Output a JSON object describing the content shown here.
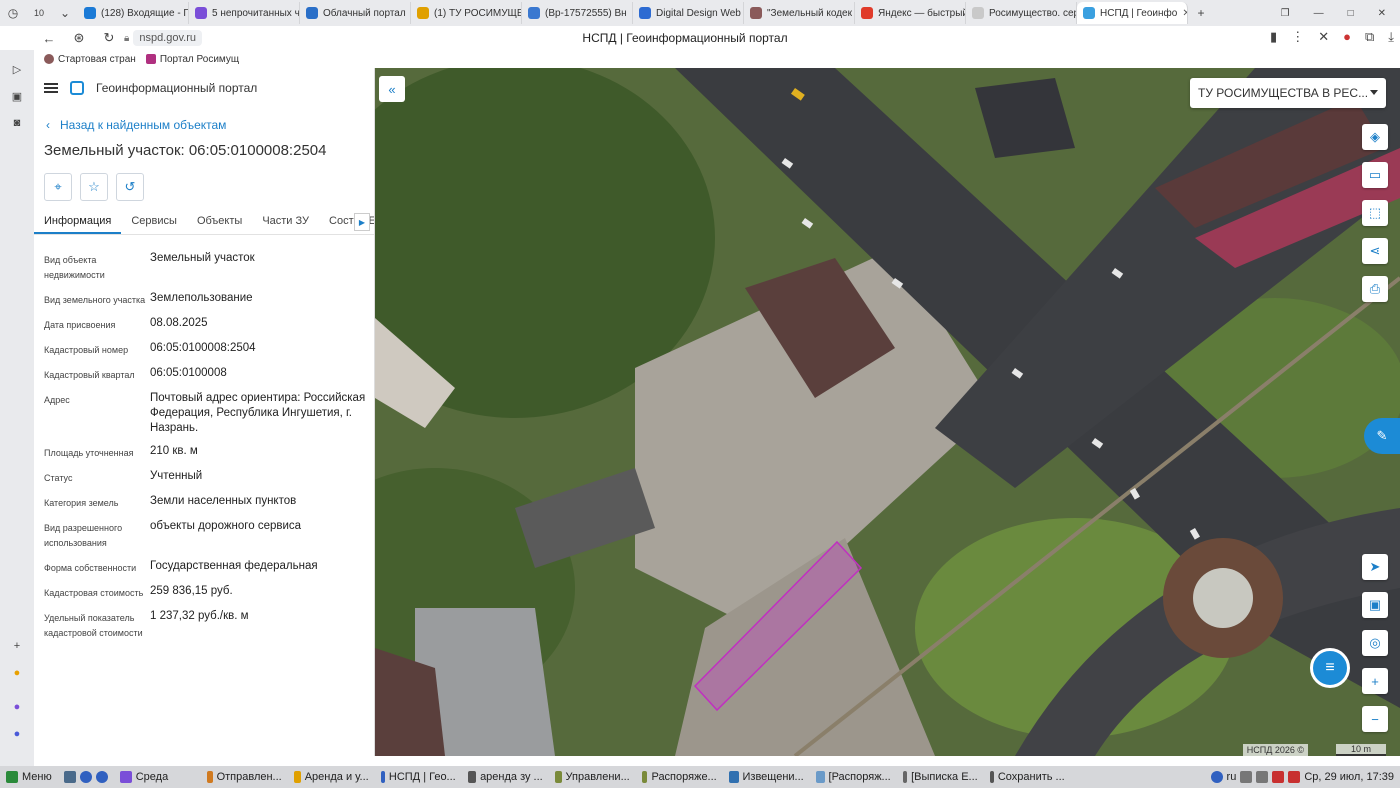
{
  "browser": {
    "tab_counter": "10",
    "tabs": [
      {
        "label": "(128) Входящие - П",
        "color": "#1b7ad6"
      },
      {
        "label": "5 непрочитанных ч",
        "color": "#7a4ed8"
      },
      {
        "label": "Облачный портал",
        "color": "#2a6fc8"
      },
      {
        "label": "(1) ТУ РОСИМУЩЕ",
        "color": "#e0a000"
      },
      {
        "label": "(Вр-17572555) Вн",
        "color": "#3a78d0"
      },
      {
        "label": "Digital Design Web",
        "color": "#2d6bd2"
      },
      {
        "label": "\"Земельный кодек",
        "color": "#8a5a5a"
      },
      {
        "label": "Яндекс — быстрый",
        "color": "#e03b2a"
      },
      {
        "label": "Росимущество. сер",
        "color": "#c9c9c9"
      },
      {
        "label": "НСПД | Геоинфо",
        "color": "#3aa0e0"
      }
    ],
    "url": "nspd.gov.ru",
    "page_title": "НСПД | Геоинформационный портал",
    "bookmarks": [
      "Стартовая стран",
      "Портал Росимущ"
    ]
  },
  "portal": {
    "name": "Геоинформационный портал",
    "back_link": "Назад к найденным объектам",
    "object_title": "Земельный участок: 06:05:0100008:2504",
    "tabs": [
      "Информация",
      "Сервисы",
      "Объекты",
      "Части ЗУ",
      "Состав Е"
    ],
    "properties": [
      {
        "key": "Вид объекта недвижимости",
        "value": "Земельный участок"
      },
      {
        "key": "Вид земельного участка",
        "value": "Землепользование"
      },
      {
        "key": "Дата присвоения",
        "value": "08.08.2025"
      },
      {
        "key": "Кадастровый номер",
        "value": "06:05:0100008:2504"
      },
      {
        "key": "Кадастровый квартал",
        "value": "06:05:0100008"
      },
      {
        "key": "Адрес",
        "value": "Почтовый адрес ориентира: Российская Федерация, Республика Ингушетия, г. Назрань."
      },
      {
        "key": "Площадь уточненная",
        "value": "210 кв. м"
      },
      {
        "key": "Статус",
        "value": "Учтенный"
      },
      {
        "key": "Категория земель",
        "value": "Земли населенных пунктов"
      },
      {
        "key": "Вид разрешенного использования",
        "value": "объекты дорожного сервиса"
      },
      {
        "key": "Форма собственности",
        "value": "Государственная федеральная"
      },
      {
        "key": "Кадастровая стоимость",
        "value": "259 836,15 руб."
      },
      {
        "key": "Удельный показатель кадастровой стоимости",
        "value": "1 237,32 руб./кв. м"
      }
    ]
  },
  "map": {
    "layer_select": "ТУ РОСИМУЩЕСТВА В РЕС...",
    "credit": "НСПД 2026 ©",
    "scale": "10 m"
  },
  "taskbar": {
    "menu": "Меню",
    "items": [
      "Среда",
      "Отправлен...",
      "Аренда и у...",
      "НСПД | Гео...",
      "аренда зу ...",
      "Управлени...",
      "Распоряже...",
      "Извещени...",
      "[Распоряж...",
      "[Выписка Е...",
      "Сохранить ..."
    ],
    "lang": "ru",
    "clock": "Ср, 29 июл, 17:39"
  }
}
